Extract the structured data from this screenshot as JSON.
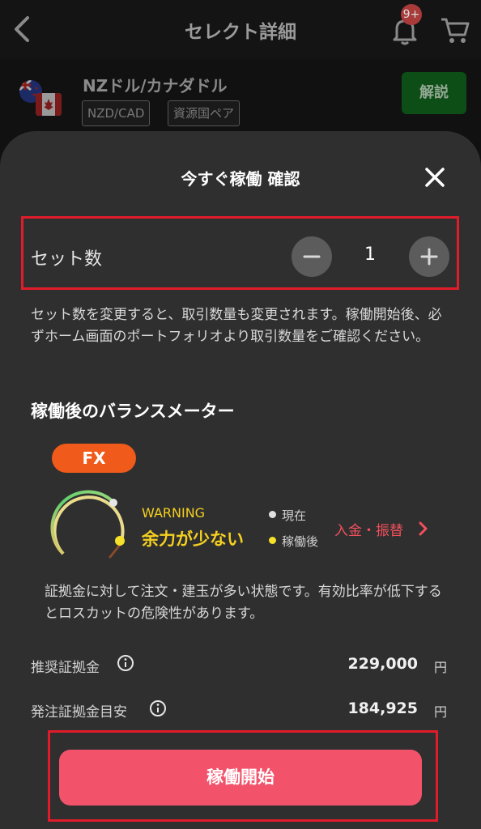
{
  "header": {
    "title": "セレクト詳細",
    "badge": "9+"
  },
  "pair": {
    "name": "NZドル/カナダドル",
    "tags": [
      "NZD/CAD",
      "資源国ペア"
    ],
    "explain_label": "解説"
  },
  "sheet": {
    "title": "今すぐ稼働 確認",
    "set": {
      "label": "セット数",
      "value": "1"
    },
    "note": "セット数を変更すると、取引数量も変更されます。稼働開始後、必ずホーム画面のポートフォリオより取引数量をご確認ください。",
    "balance": {
      "title": "稼働後のバランスメーター",
      "pill": "FX",
      "status_label": "WARNING",
      "status_text": "余力が少ない",
      "legend_current": "現在",
      "legend_after": "稼働後",
      "deposit_link": "入金・振替",
      "description": "証拠金に対して注文・建玉が多い状態です。有効比率が低下するとロスカットの危険性があります。"
    },
    "rows": [
      {
        "label": "推奨証拠金",
        "value": "229,000",
        "unit": "円"
      },
      {
        "label": "発注証拠金目安",
        "value": "184,925",
        "unit": "円"
      }
    ],
    "start_button": "稼働開始"
  },
  "colors": {
    "accent": "#f2526a",
    "warning": "#f5d020",
    "highlight_border": "#e11c2a",
    "fx_pill": "#f05a1a"
  }
}
